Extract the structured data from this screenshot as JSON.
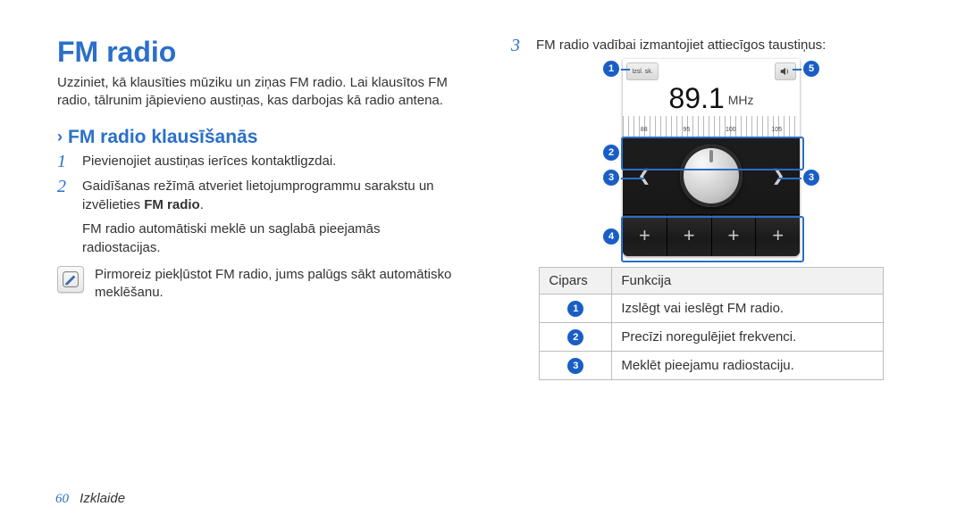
{
  "title": "FM radio",
  "intro": "Uzziniet, kā klausīties mūziku un ziņas FM radio. Lai klausītos FM radio, tālrunim jāpievieno austiņas, kas darbojas kā radio antena.",
  "subhead": "FM radio klausīšanās",
  "steps": {
    "s1": "Pievienojiet austiņas ierīces kontaktligzdai.",
    "s2_a": "Gaidīšanas režīmā atveriet lietojumprogrammu sarakstu un izvēlieties ",
    "s2_b": "FM radio",
    "s2_c": ".",
    "s2_sub": "FM radio automātiski meklē un saglabā pieejamās radiostacijas.",
    "note": "Pirmoreiz piekļūstot FM radio, jums palūgs sākt automātisko meklēšanu."
  },
  "right": {
    "s3": "FM radio vadībai izmantojiet attiecīgos taustiņus:"
  },
  "radio": {
    "power_label": "Izsl. sk.",
    "freq": "89.1",
    "unit": "MHz",
    "ticks": [
      "88",
      "95",
      "100",
      "105"
    ]
  },
  "table": {
    "h1": "Cipars",
    "h2": "Funkcija",
    "r1": "Izslēgt vai ieslēgt FM radio.",
    "r2": "Precīzi noregulējiet frekvenci.",
    "r3": "Meklēt pieejamu radiostaciju."
  },
  "footer": {
    "page": "60",
    "section": "Izklaide"
  }
}
